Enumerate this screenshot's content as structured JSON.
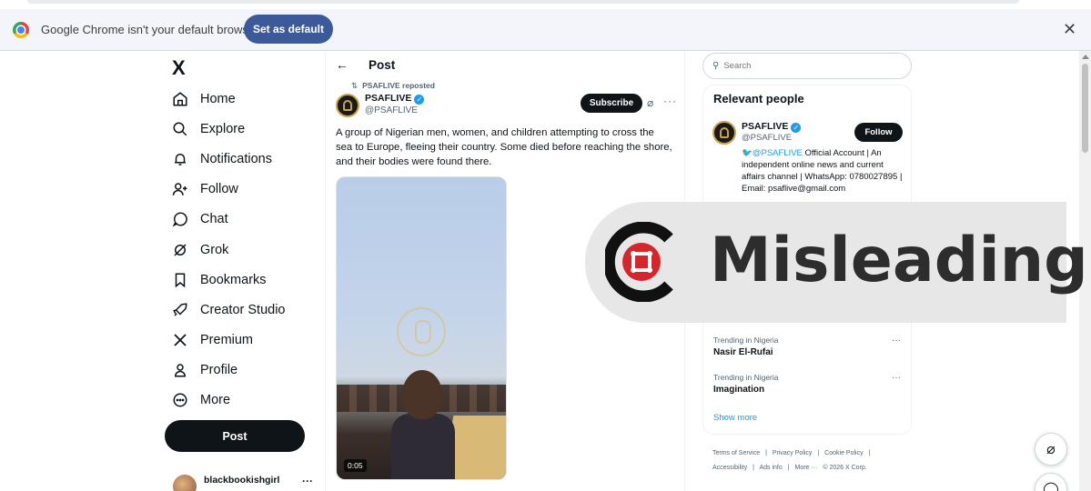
{
  "infobar": {
    "message": "Google Chrome isn't your default browser",
    "set_default_label": "Set as default",
    "close_icon": "close-icon"
  },
  "nav": {
    "logo": "X",
    "items": [
      {
        "label": "Home",
        "icon": "home-icon"
      },
      {
        "label": "Explore",
        "icon": "search-icon"
      },
      {
        "label": "Notifications",
        "icon": "bell-icon"
      },
      {
        "label": "Follow",
        "icon": "person-add-icon"
      },
      {
        "label": "Chat",
        "icon": "chat-icon"
      },
      {
        "label": "Grok",
        "icon": "grok-icon"
      },
      {
        "label": "Bookmarks",
        "icon": "bookmark-icon"
      },
      {
        "label": "Creator Studio",
        "icon": "rocket-icon"
      },
      {
        "label": "Premium",
        "icon": "x-icon"
      },
      {
        "label": "Profile",
        "icon": "person-icon"
      },
      {
        "label": "More",
        "icon": "more-circle-icon"
      }
    ],
    "post_label": "Post",
    "account_name": "blackbookishgirl"
  },
  "post": {
    "header": "Post",
    "reposted_by": "PSAFLIVE reposted",
    "author_name": "PSAFLIVE",
    "author_handle": "@PSAFLIVE",
    "subscribe_label": "Subscribe",
    "text": "A group of Nigerian men, women, and children attempting to cross the sea to Europe, fleeing their country. Some died before reaching the shore, and their bodies were found there.",
    "video_time": "0:05"
  },
  "sidebar": {
    "search_placeholder": "Search",
    "relevant_title": "Relevant people",
    "person": {
      "name": "PSAFLIVE",
      "handle": "@PSAFLIVE",
      "follow_label": "Follow",
      "bio_mention": "@PSAFLIVE",
      "bio_rest": " Official Account | An independent online news and current affairs channel | WhatsApp: 0780027895 | Email: psaflive@gmail.com"
    },
    "trends": [
      {
        "category": "Trending in Nigeria",
        "title": "Nasir El-Rufai"
      },
      {
        "category": "Trending in Nigeria",
        "title": "Imagination"
      }
    ],
    "show_more": "Show more",
    "footer": [
      "Terms of Service",
      "|",
      "Privacy Policy",
      "|",
      "Cookie Policy",
      "|",
      "Accessibility",
      "|",
      "Ads info",
      "|",
      "More ···",
      "© 2026 X Corp."
    ]
  },
  "overlay": {
    "label": "Misleading",
    "accent": "#d7262b"
  }
}
